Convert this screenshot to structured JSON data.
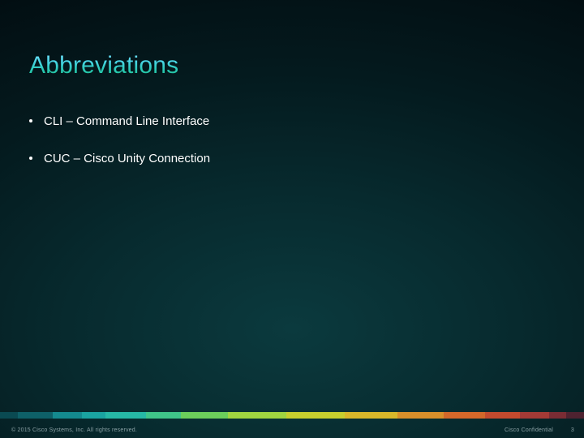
{
  "title": "Abbreviations",
  "bullets": [
    "CLI – Command Line Interface",
    "CUC – Cisco Unity Connection"
  ],
  "footer": {
    "copyright": "© 2015 Cisco Systems, Inc. All rights reserved.",
    "confidential": "Cisco Confidential",
    "page": "3"
  }
}
